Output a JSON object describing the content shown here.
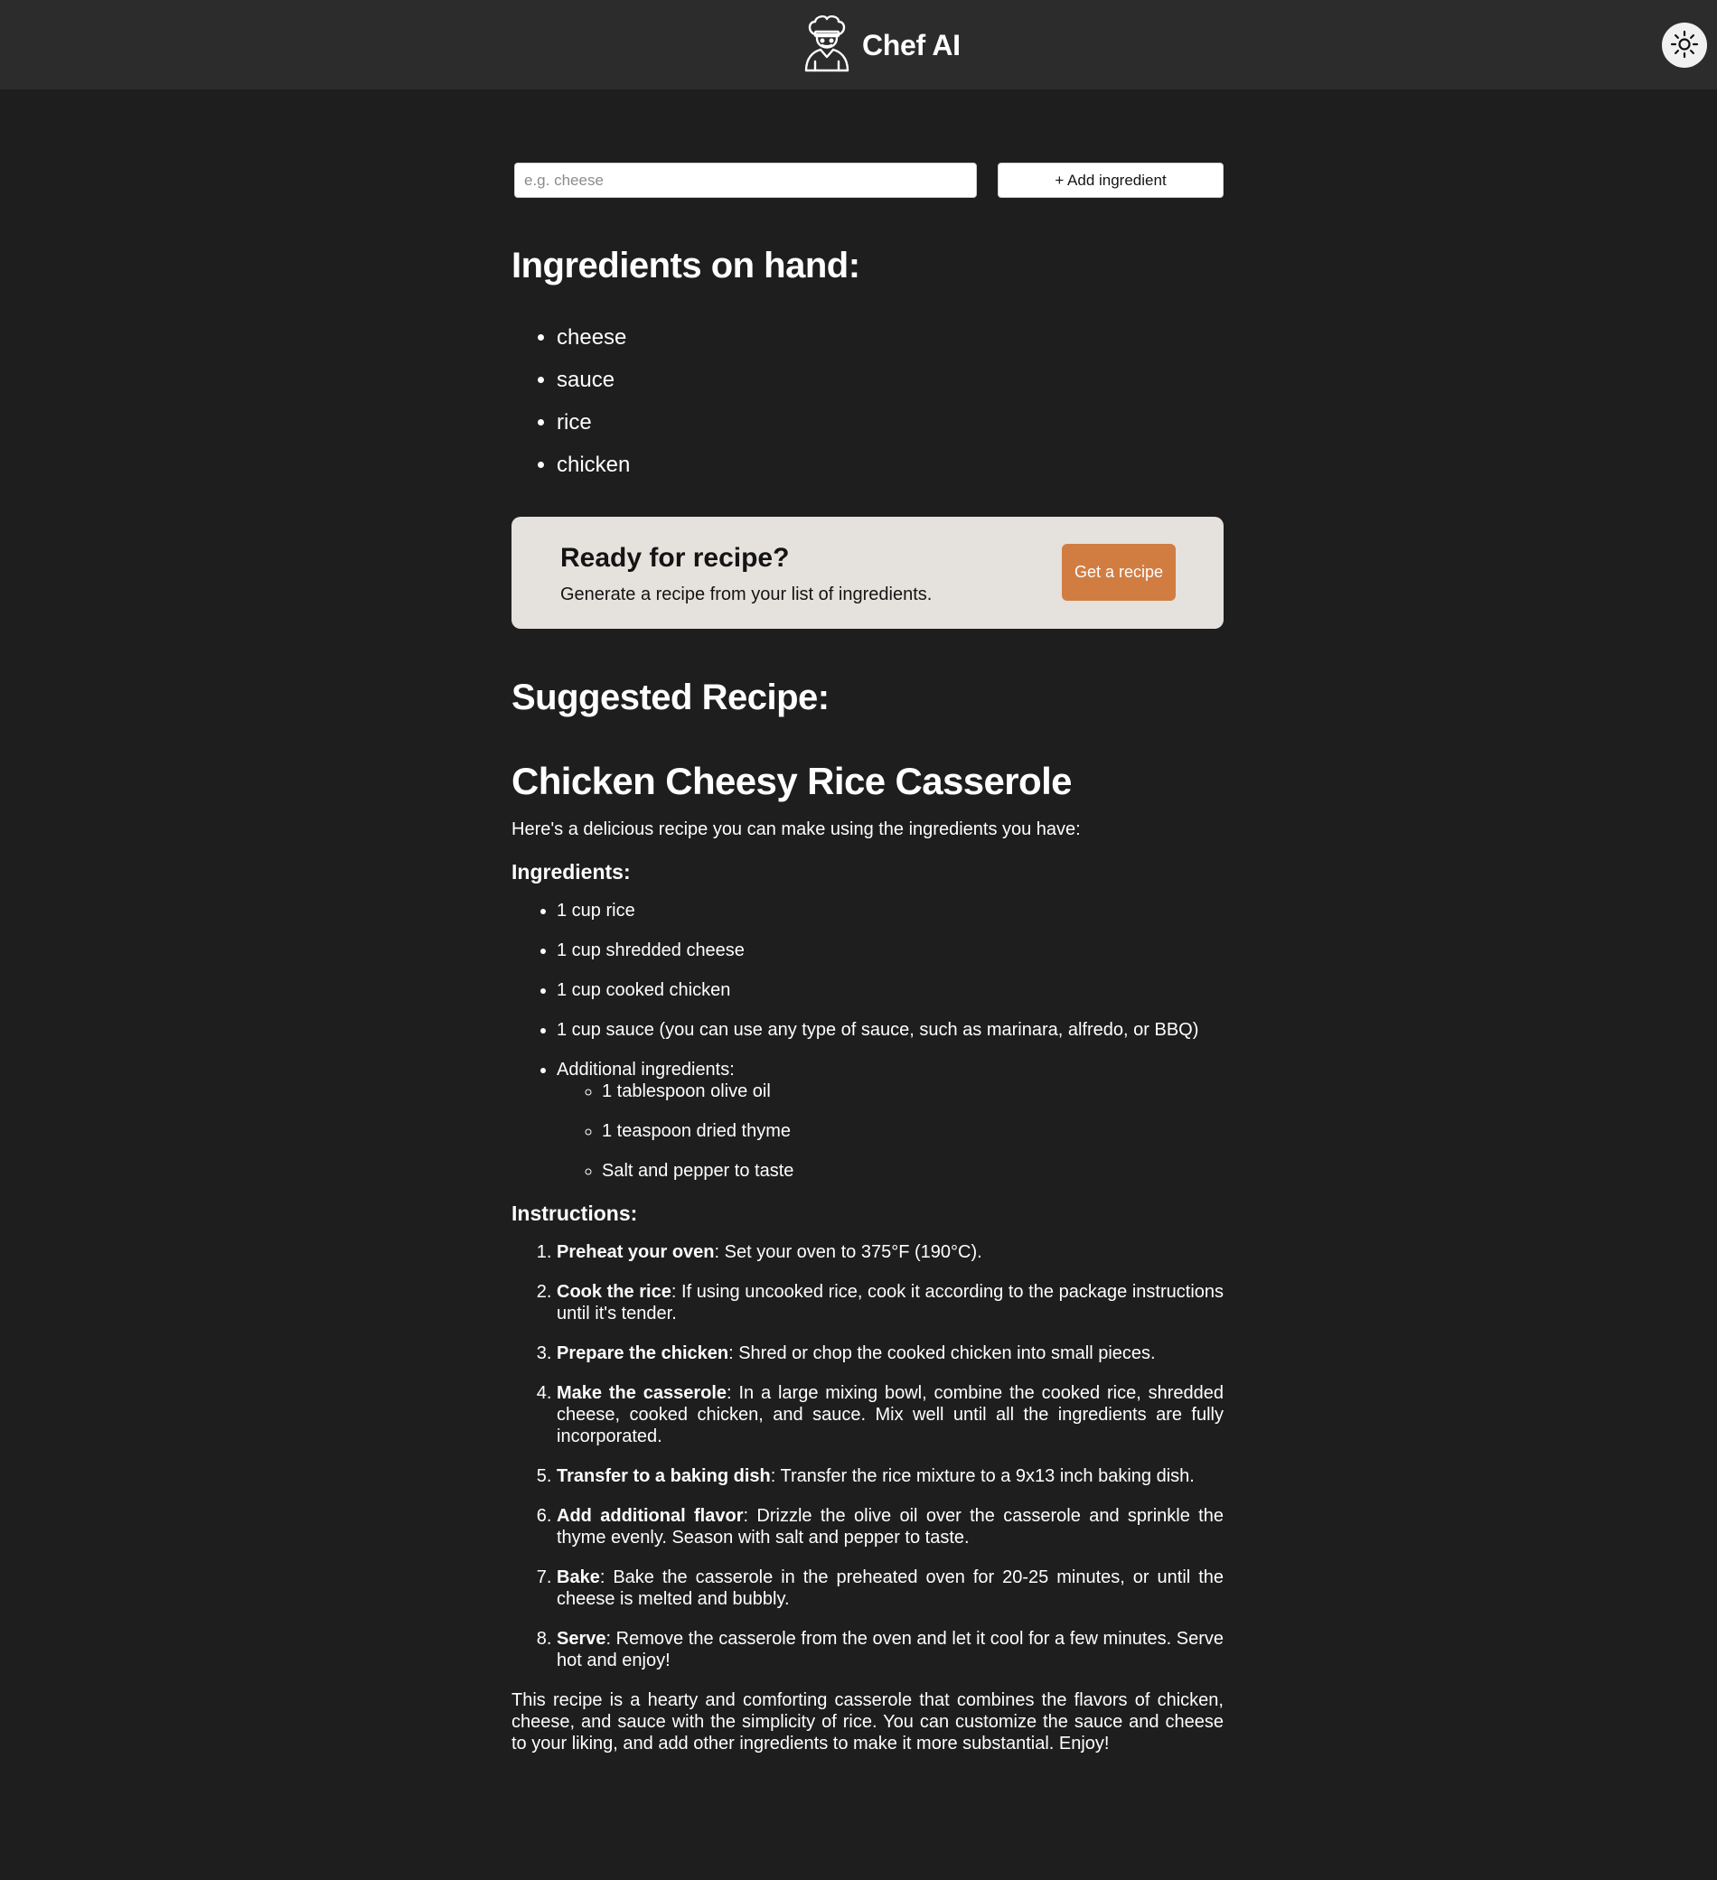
{
  "header": {
    "app_name": "Chef AI",
    "logo_icon": "chef-icon",
    "theme_icon": "sun-icon"
  },
  "form": {
    "placeholder": "e.g. cheese",
    "value": "",
    "add_button": "+ Add ingredient"
  },
  "onhand": {
    "title": "Ingredients on hand:",
    "items": [
      "cheese",
      "sauce",
      "rice",
      "chicken"
    ]
  },
  "cta": {
    "title": "Ready for recipe?",
    "subtitle": "Generate a recipe from your list of ingredients.",
    "button": "Get a recipe",
    "button_color": "#d17d42",
    "panel_color": "#e5e1dc"
  },
  "suggested": {
    "title": "Suggested Recipe:"
  },
  "recipe": {
    "name": "Chicken Cheesy Rice Casserole",
    "intro": "Here's a delicious recipe you can make using the ingredients you have:",
    "ingredients_heading": "Ingredients:",
    "ingredients": [
      "1 cup rice",
      "1 cup shredded cheese",
      "1 cup cooked chicken",
      "1 cup sauce (you can use any type of sauce, such as marinara, alfredo, or BBQ)"
    ],
    "additional_label": "Additional ingredients:",
    "additional": [
      "1 tablespoon olive oil",
      "1 teaspoon dried thyme",
      "Salt and pepper to taste"
    ],
    "instructions_heading": "Instructions:",
    "steps": [
      {
        "title": "Preheat your oven",
        "text": ": Set your oven to 375°F (190°C)."
      },
      {
        "title": "Cook the rice",
        "text": ": If using uncooked rice, cook it according to the package instructions until it's tender."
      },
      {
        "title": "Prepare the chicken",
        "text": ": Shred or chop the cooked chicken into small pieces."
      },
      {
        "title": "Make the casserole",
        "text": ": In a large mixing bowl, combine the cooked rice, shredded cheese, cooked chicken, and sauce. Mix well until all the ingredients are fully incorporated."
      },
      {
        "title": "Transfer to a baking dish",
        "text": ": Transfer the rice mixture to a 9x13 inch baking dish."
      },
      {
        "title": "Add additional flavor",
        "text": ": Drizzle the olive oil over the casserole and sprinkle the thyme evenly. Season with salt and pepper to taste."
      },
      {
        "title": "Bake",
        "text": ": Bake the casserole in the preheated oven for 20-25 minutes, or until the cheese is melted and bubbly."
      },
      {
        "title": "Serve",
        "text": ": Remove the casserole from the oven and let it cool for a few minutes. Serve hot and enjoy!"
      }
    ],
    "outro": "This recipe is a hearty and comforting casserole that combines the flavors of chicken, cheese, and sauce with the simplicity of rice. You can customize the sauce and cheese to your liking, and add other ingredients to make it more substantial. Enjoy!"
  }
}
